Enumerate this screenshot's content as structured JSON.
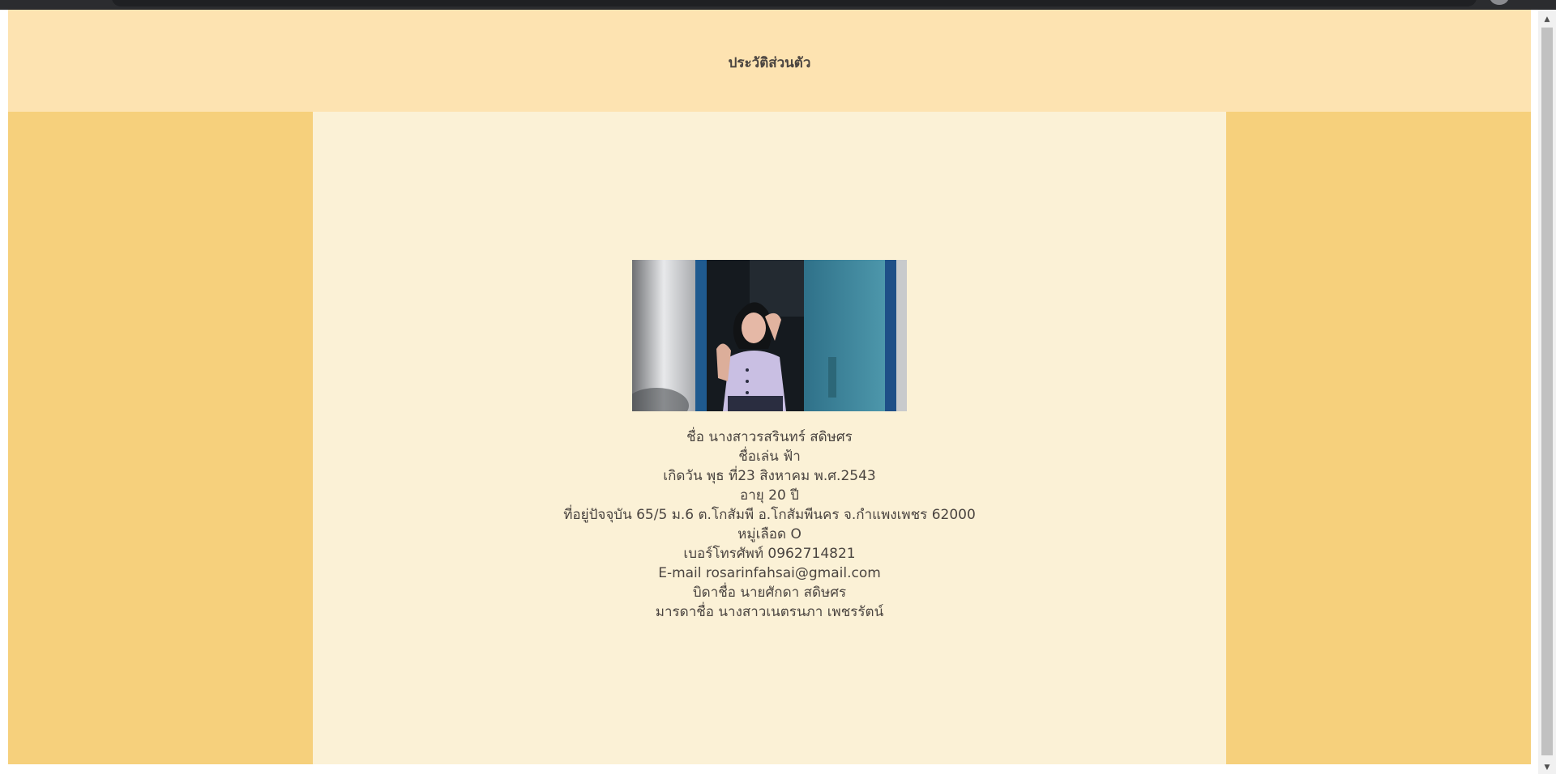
{
  "header": {
    "title": "ประวัติส่วนตัว"
  },
  "profile": {
    "photo_alt": "profile-photo",
    "lines": [
      "ชื่อ นางสาวรสรินทร์ สดิษศร",
      "ชื่อเล่น ฟ้า",
      "เกิดวัน พุธ ที่23 สิงหาคม พ.ศ.2543",
      "อายุ 20 ปี",
      "ที่อยู่ปัจจุบัน 65/5 ม.6 ต.โกสัมพี อ.โกสัมพีนคร จ.กำแพงเพชร 62000",
      "หมู่เลือด O",
      "เบอร์โทรศัพท์ 0962714821",
      "E-mail rosarinfahsai@gmail.com",
      "บิดาชื่อ นายศักดา สดิษศร",
      "มารดาชื่อ นางสาวเนตรนภา เพชรรัตน์"
    ]
  },
  "colors": {
    "header_bg": "#fde3b1",
    "side_bg": "#f6d07c",
    "center_bg": "#fbf1d6",
    "text": "#4a4440"
  },
  "scrollbar": {
    "up_icon": "triangle-up-icon",
    "down_icon": "triangle-down-icon"
  }
}
